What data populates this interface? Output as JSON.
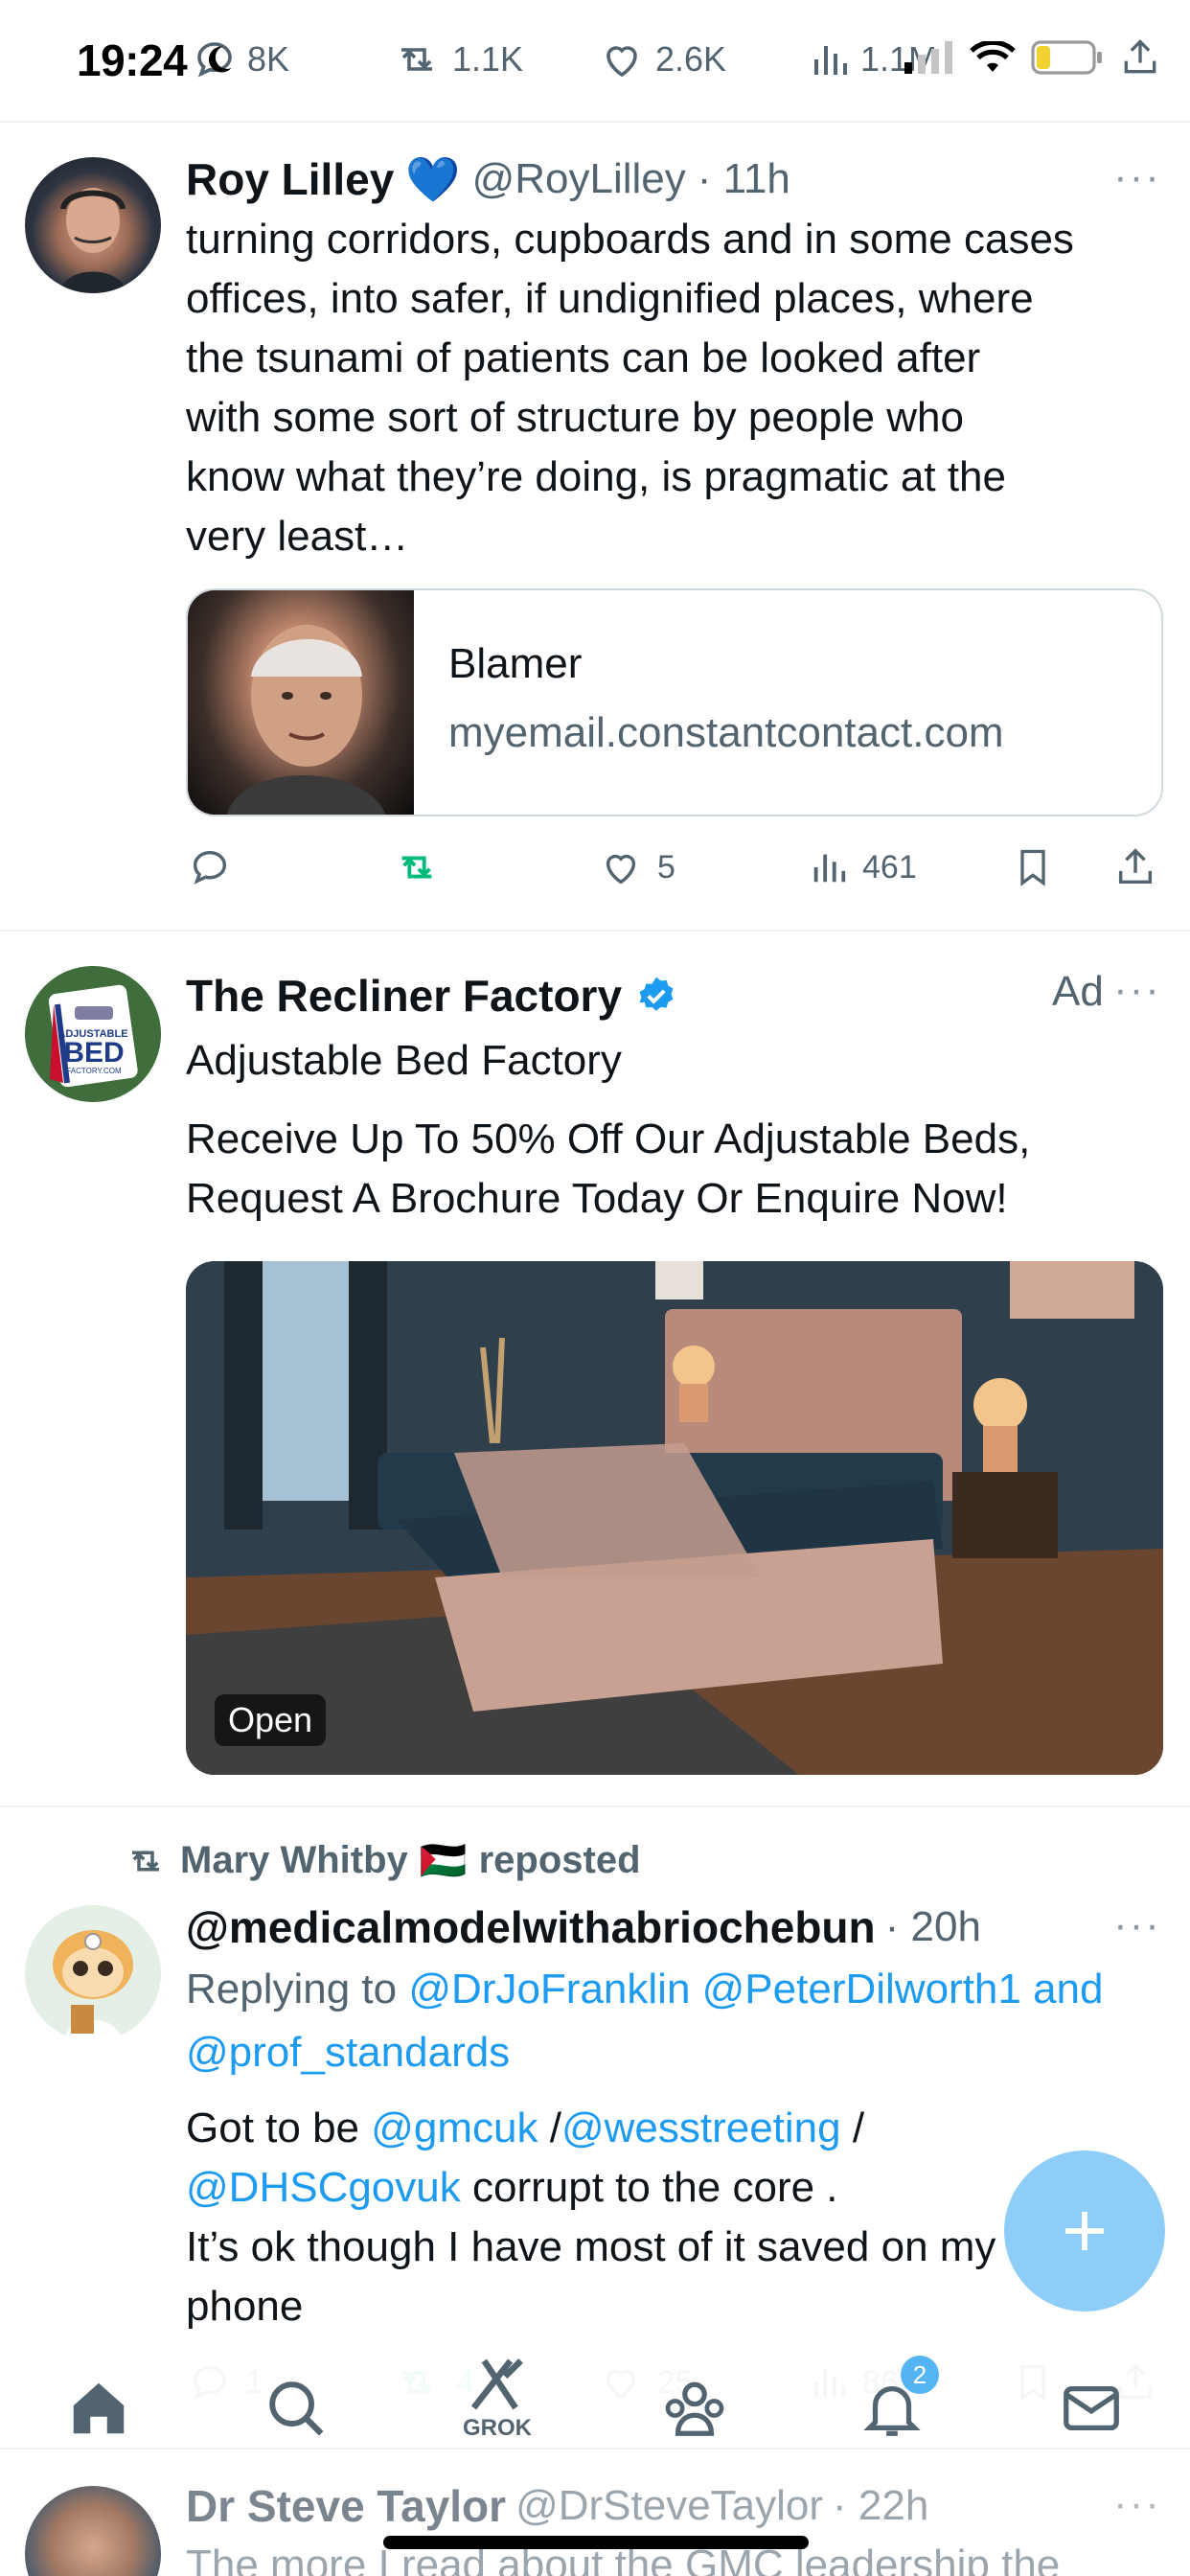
{
  "status_bar": {
    "time": "19:24"
  },
  "top_actions": {
    "replies": "8K",
    "reposts": "1.1K",
    "likes": "2.6K",
    "views": "1.1M"
  },
  "tweet1": {
    "name": "Roy Lilley",
    "heart_emoji": "💙",
    "handle": "@RoyLilley",
    "time": "· 11h",
    "lines": [
      "turning corridors, cupboards and in some cases",
      "offices, into safer, if undignified places, where",
      "the tsunami of patients can be looked after",
      "with some sort of structure by people who",
      "know what they’re doing, is pragmatic at the",
      "very least…"
    ],
    "card": {
      "title": "Blamer",
      "domain": "myemail.constantcontact.com"
    },
    "likes": "5",
    "views": "461"
  },
  "ad": {
    "name": "The Recliner Factory",
    "label": "Ad",
    "subtitle": "Adjustable Bed Factory",
    "lines": [
      "Receive Up To 50% Off Our Adjustable Beds,",
      "Request A Brochure Today Or Enquire Now!"
    ],
    "logo_text": {
      "top": "ADJUSTABLE",
      "main": "BED",
      "bottom": "FACTORY.COM"
    },
    "open_label": "Open"
  },
  "tweet2": {
    "repost_by": "Mary Whitby",
    "repost_suffix": "reposted",
    "flag_emoji": "🇵🇸",
    "handle": "@medicalmodelwithabriochebun",
    "time": "· 20h",
    "replying_prefix": "Replying to ",
    "replying_1": "@DrJoFranklin @PeterDilworth1 and",
    "replying_2": "@prof_standards",
    "line1_a": "Got to be ",
    "line1_m1": "@gmcuk",
    "line1_b": " /",
    "line1_m2": "@wesstreeting",
    "line1_c": " /",
    "line2_m": "@DHSCgovuk",
    "line2_b": " corrupt to the core .",
    "line3": "It’s ok though I have most of it saved on my",
    "line4": "phone",
    "replies": "1",
    "reposts": "4",
    "likes": "25",
    "views": "862"
  },
  "tweet3": {
    "name": "Dr Steve Taylor",
    "handle": "@DrSteveTaylor",
    "time": "· 22h",
    "line": "The more I read about the GMC leadership the"
  },
  "nav": {
    "grok_label": "GROK",
    "notifications_badge": "2"
  },
  "colors": {
    "accent": "#1d9bf0",
    "repost_green": "#00ba7c",
    "muted": "#536471"
  }
}
